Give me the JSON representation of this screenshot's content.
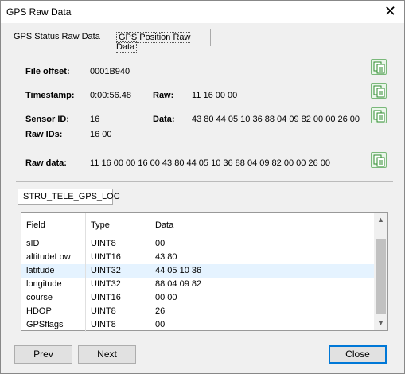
{
  "window": {
    "title": "GPS Raw Data",
    "close_glyph": "✕"
  },
  "tabs": [
    {
      "label": "GPS Status Raw Data"
    },
    {
      "label": "GPS Position Raw Data"
    }
  ],
  "fields": {
    "file_offset_label": "File offset:",
    "file_offset_value": "0001B940",
    "timestamp_label": "Timestamp:",
    "timestamp_value": "0:00:56.48",
    "raw_label": "Raw:",
    "raw_value": "11 16 00 00",
    "sensor_id_label": "Sensor ID:",
    "sensor_id_value": "16",
    "data_label": "Data:",
    "data_value": "43 80 44 05 10 36 88 04 09 82 00 00 26 00",
    "raw_ids_label": "Raw IDs:",
    "raw_ids_value": "16 00",
    "raw_data_label": "Raw data:",
    "raw_data_value": "11 16 00 00 16 00 43 80 44 05 10 36 88 04 09 82 00 00 26 00"
  },
  "struct_tab": {
    "label": "STRU_TELE_GPS_LOC"
  },
  "grid": {
    "headers": {
      "field": "Field",
      "type": "Type",
      "data": "Data"
    },
    "rows": [
      {
        "field": "sID",
        "type": "UINT8",
        "data": "00"
      },
      {
        "field": "altitudeLow",
        "type": "UINT16",
        "data": "43 80"
      },
      {
        "field": "latitude",
        "type": "UINT32",
        "data": "44 05 10 36"
      },
      {
        "field": "longitude",
        "type": "UINT32",
        "data": "88 04 09 82"
      },
      {
        "field": "course",
        "type": "UINT16",
        "data": "00 00"
      },
      {
        "field": "HDOP",
        "type": "UINT8",
        "data": "26"
      },
      {
        "field": "GPSflags",
        "type": "UINT8",
        "data": "00"
      }
    ],
    "selected_row": 2,
    "scroll_up_glyph": "▲",
    "scroll_down_glyph": "▼"
  },
  "buttons": {
    "prev": "Prev",
    "next": "Next",
    "close": "Close"
  },
  "colors": {
    "accent": "#0078d7",
    "copy_icon": "#2e8b2e",
    "selected_row": "#e5f3ff"
  }
}
